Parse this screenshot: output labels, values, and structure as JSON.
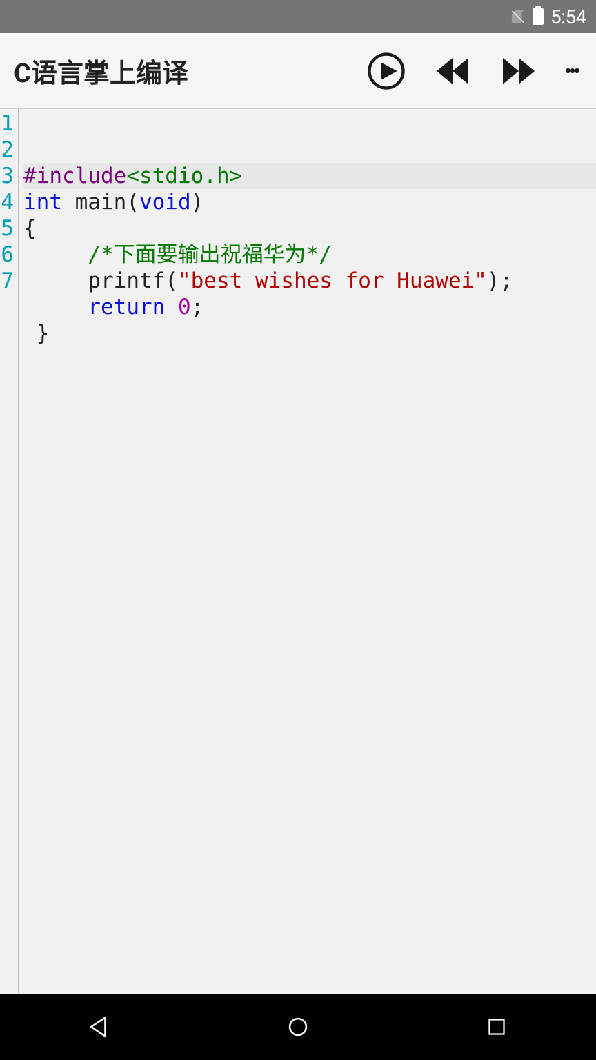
{
  "status": {
    "time": "5:54"
  },
  "app": {
    "title": "C语言掌上编译"
  },
  "gutter": {
    "l1": "1",
    "l2": "2",
    "l3": "3",
    "l4": "4",
    "l5": "5",
    "l6": "6",
    "l7": "7"
  },
  "code": {
    "l1_pp": "#include",
    "l1_hdr": "<stdio.h>",
    "l2_kw1": "int",
    "l2_id": " main(",
    "l2_kw2": "void",
    "l2_end": ")",
    "l3": "{",
    "l4_indent": "     ",
    "l4_cmt": "/*下面要输出祝福华为*/",
    "l5_indent": "     ",
    "l5_fn": "printf(",
    "l5_str": "\"best wishes for Huawei\"",
    "l5_end": ");",
    "l6_indent": "     ",
    "l6_kw": "return",
    "l6_sp": " ",
    "l6_num": "0",
    "l6_end": ";",
    "l7": " }"
  }
}
